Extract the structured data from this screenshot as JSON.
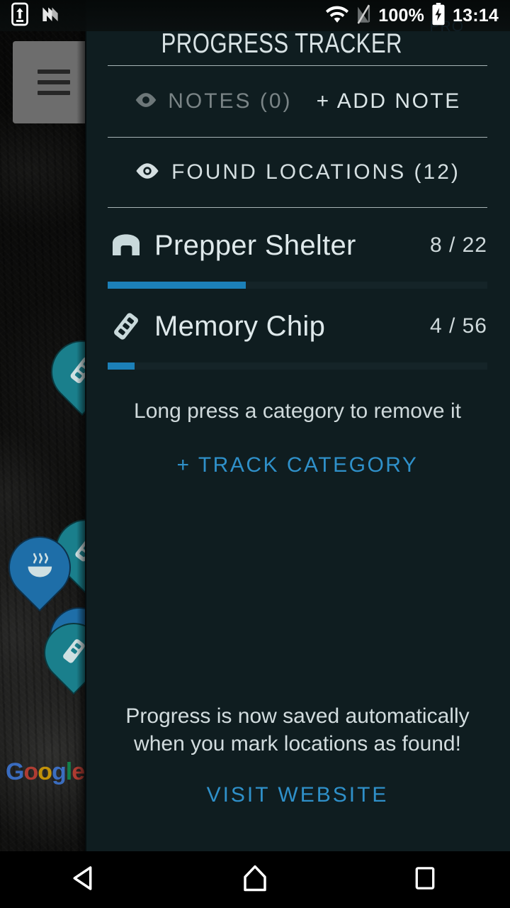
{
  "status_bar": {
    "left_icons": [
      "usb-transfer-icon",
      "nova-n-icon"
    ],
    "wifi_icon": "wifi-icon",
    "signal_icon": "no-sim-signal-icon",
    "battery_percent": "100%",
    "battery_icon": "battery-charging-icon",
    "time": "13:14"
  },
  "map": {
    "menu_button": "hamburger-menu-button",
    "watermark": {
      "g1": "G",
      "g2": "o",
      "g3": "o",
      "g4": "g",
      "g5": "l",
      "g6": "e"
    },
    "pins": [
      {
        "icon": "memory-chip-icon",
        "color": "#1a7f8c"
      },
      {
        "icon": "memory-chip-icon",
        "color": "#1a7f8c"
      },
      {
        "icon": "steam-bowl-icon",
        "color": "#1e6ea8"
      },
      {
        "icon": "steam-bowl-icon",
        "color": "#1e6ea8"
      },
      {
        "icon": "memory-chip-icon",
        "color": "#1a7f8c"
      }
    ]
  },
  "drawer": {
    "title": "PROGRESS TRACKER",
    "pro_badge": "PRO",
    "notes": {
      "eye_icon": "eye-icon",
      "label": "NOTES (0)",
      "add_label": "+ ADD NOTE"
    },
    "found_locations": {
      "eye_icon": "eye-icon",
      "label": "FOUND LOCATIONS (12)"
    },
    "categories": [
      {
        "icon": "bunker-shelter-icon",
        "name": "Prepper Shelter",
        "count": "8 / 22",
        "found": 8,
        "total": 22,
        "percent": 36.4
      },
      {
        "icon": "memory-chip-icon",
        "name": "Memory Chip",
        "count": "4 / 56",
        "found": 4,
        "total": 56,
        "percent": 7.1
      }
    ],
    "hint": "Long press a category to remove it",
    "track_category": "+ TRACK CATEGORY",
    "footer_message": "Progress is now saved automatically when you mark locations as found!",
    "visit_website": "VISIT WEBSITE"
  },
  "nav_bar": {
    "back": "back-triangle-icon",
    "home": "home-pentagon-icon",
    "recents": "recents-square-icon"
  },
  "colors": {
    "drawer_bg": "#0f1d20",
    "accent_blue": "#2f90c9",
    "progress_fill": "#1c80b8",
    "progress_track": "#152428",
    "text_primary": "#dfe9eb",
    "text_muted": "#7a8486",
    "pin_teal": "#1a7f8c",
    "pin_blue": "#1e6ea8"
  }
}
